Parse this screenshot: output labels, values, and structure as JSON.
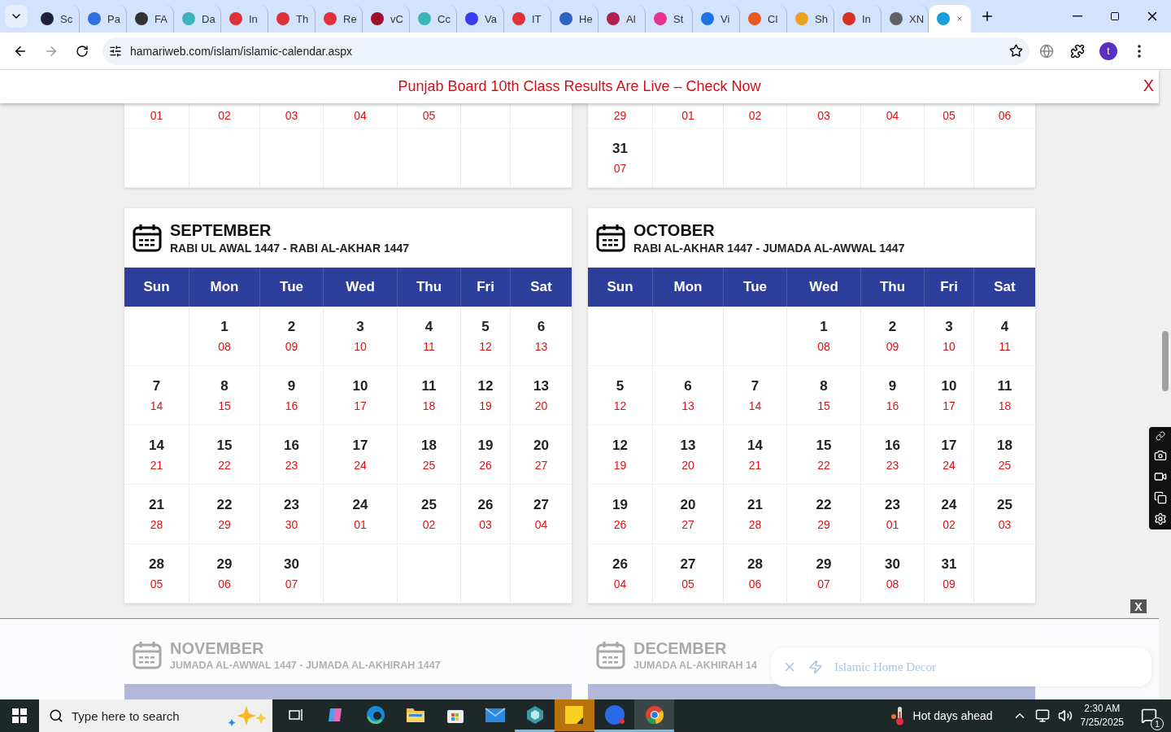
{
  "browser": {
    "tabs": [
      {
        "label": "Sc",
        "selected": false,
        "color": "#1f1f3a"
      },
      {
        "label": "Pa",
        "selected": false,
        "color": "#2f6fe0"
      },
      {
        "label": "FA",
        "selected": false,
        "color": "#333333"
      },
      {
        "label": "Da",
        "selected": false,
        "color": "#3bb3b8"
      },
      {
        "label": "In",
        "selected": false,
        "color": "#e0303a"
      },
      {
        "label": "Th",
        "selected": false,
        "color": "#e0303a"
      },
      {
        "label": "Re",
        "selected": false,
        "color": "#e0303a"
      },
      {
        "label": "vC",
        "selected": false,
        "color": "#a0102a"
      },
      {
        "label": "Cc",
        "selected": false,
        "color": "#3bb3b8"
      },
      {
        "label": "Va",
        "selected": false,
        "color": "#3a3af0"
      },
      {
        "label": "IT",
        "selected": false,
        "color": "#e0303a"
      },
      {
        "label": "He",
        "selected": false,
        "color": "#3060c0"
      },
      {
        "label": "Al",
        "selected": false,
        "color": "#b02050"
      },
      {
        "label": "St",
        "selected": false,
        "color": "#e83090"
      },
      {
        "label": "Vi",
        "selected": false,
        "color": "#1a73e8"
      },
      {
        "label": "Cl",
        "selected": false,
        "color": "#e85a20"
      },
      {
        "label": "Sh",
        "selected": false,
        "color": "#f0a020"
      },
      {
        "label": "In",
        "selected": false,
        "color": "#d93025"
      },
      {
        "label": "XN",
        "selected": false,
        "color": "#5f6368"
      },
      {
        "selected": true,
        "color": "#1aa0d8"
      }
    ],
    "url": "hamariweb.com/islam/islamic-calendar.aspx",
    "profile": "t"
  },
  "banner": {
    "text": "Punjab Board 10th Class Results Are Live – Check Now",
    "close": "X"
  },
  "previous_months": [
    {
      "rows": [
        [
          {
            "hijri": "01"
          },
          {
            "hijri": "02"
          },
          {
            "hijri": "03"
          },
          {
            "hijri": "04"
          },
          {
            "hijri": "05"
          },
          {},
          {}
        ],
        [
          {},
          {},
          {},
          {},
          {},
          {},
          {}
        ]
      ]
    },
    {
      "rows": [
        [
          {
            "hijri": "29"
          },
          {
            "hijri": "01"
          },
          {
            "hijri": "02"
          },
          {
            "hijri": "03"
          },
          {
            "hijri": "04"
          },
          {
            "hijri": "05"
          },
          {
            "hijri": "06"
          }
        ],
        [
          {
            "day": "31",
            "hijri": "07"
          },
          {},
          {},
          {},
          {},
          {},
          {}
        ]
      ]
    }
  ],
  "months": [
    {
      "name": "SEPTEMBER",
      "subtitle": "RABI UL AWAL 1447 - RABI AL-AKHAR 1447",
      "weekdays": [
        "Sun",
        "Mon",
        "Tue",
        "Wed",
        "Thu",
        "Fri",
        "Sat"
      ],
      "rows": [
        [
          {},
          {
            "day": "1",
            "hijri": "08"
          },
          {
            "day": "2",
            "hijri": "09"
          },
          {
            "day": "3",
            "hijri": "10"
          },
          {
            "day": "4",
            "hijri": "11"
          },
          {
            "day": "5",
            "hijri": "12"
          },
          {
            "day": "6",
            "hijri": "13"
          }
        ],
        [
          {
            "day": "7",
            "hijri": "14"
          },
          {
            "day": "8",
            "hijri": "15"
          },
          {
            "day": "9",
            "hijri": "16"
          },
          {
            "day": "10",
            "hijri": "17"
          },
          {
            "day": "11",
            "hijri": "18"
          },
          {
            "day": "12",
            "hijri": "19"
          },
          {
            "day": "13",
            "hijri": "20"
          }
        ],
        [
          {
            "day": "14",
            "hijri": "21"
          },
          {
            "day": "15",
            "hijri": "22"
          },
          {
            "day": "16",
            "hijri": "23"
          },
          {
            "day": "17",
            "hijri": "24"
          },
          {
            "day": "18",
            "hijri": "25"
          },
          {
            "day": "19",
            "hijri": "26"
          },
          {
            "day": "20",
            "hijri": "27"
          }
        ],
        [
          {
            "day": "21",
            "hijri": "28"
          },
          {
            "day": "22",
            "hijri": "29"
          },
          {
            "day": "23",
            "hijri": "30"
          },
          {
            "day": "24",
            "hijri": "01"
          },
          {
            "day": "25",
            "hijri": "02"
          },
          {
            "day": "26",
            "hijri": "03"
          },
          {
            "day": "27",
            "hijri": "04"
          }
        ],
        [
          {
            "day": "28",
            "hijri": "05"
          },
          {
            "day": "29",
            "hijri": "06"
          },
          {
            "day": "30",
            "hijri": "07"
          },
          {},
          {},
          {},
          {}
        ]
      ]
    },
    {
      "name": "OCTOBER",
      "subtitle": "RABI AL-AKHAR 1447 - JUMADA AL-AWWAL 1447",
      "weekdays": [
        "Sun",
        "Mon",
        "Tue",
        "Wed",
        "Thu",
        "Fri",
        "Sat"
      ],
      "rows": [
        [
          {},
          {},
          {},
          {
            "day": "1",
            "hijri": "08"
          },
          {
            "day": "2",
            "hijri": "09"
          },
          {
            "day": "3",
            "hijri": "10"
          },
          {
            "day": "4",
            "hijri": "11"
          }
        ],
        [
          {
            "day": "5",
            "hijri": "12"
          },
          {
            "day": "6",
            "hijri": "13"
          },
          {
            "day": "7",
            "hijri": "14"
          },
          {
            "day": "8",
            "hijri": "15"
          },
          {
            "day": "9",
            "hijri": "16"
          },
          {
            "day": "10",
            "hijri": "17"
          },
          {
            "day": "11",
            "hijri": "18"
          }
        ],
        [
          {
            "day": "12",
            "hijri": "19"
          },
          {
            "day": "13",
            "hijri": "20"
          },
          {
            "day": "14",
            "hijri": "21"
          },
          {
            "day": "15",
            "hijri": "22"
          },
          {
            "day": "16",
            "hijri": "23"
          },
          {
            "day": "17",
            "hijri": "24"
          },
          {
            "day": "18",
            "hijri": "25"
          }
        ],
        [
          {
            "day": "19",
            "hijri": "26"
          },
          {
            "day": "20",
            "hijri": "27"
          },
          {
            "day": "21",
            "hijri": "28"
          },
          {
            "day": "22",
            "hijri": "29"
          },
          {
            "day": "23",
            "hijri": "01"
          },
          {
            "day": "24",
            "hijri": "02"
          },
          {
            "day": "25",
            "hijri": "03"
          }
        ],
        [
          {
            "day": "26",
            "hijri": "04"
          },
          {
            "day": "27",
            "hijri": "05"
          },
          {
            "day": "28",
            "hijri": "06"
          },
          {
            "day": "29",
            "hijri": "07"
          },
          {
            "day": "30",
            "hijri": "08"
          },
          {
            "day": "31",
            "hijri": "09"
          },
          {}
        ]
      ]
    }
  ],
  "ad_overlay": {
    "close": "X",
    "faded_months": [
      {
        "name": "NOVEMBER",
        "subtitle": "JUMADA AL-AWWAL 1447 - JUMADA AL-AKHIRAH 1447"
      },
      {
        "name": "DECEMBER",
        "subtitle": "JUMADA AL-AKHIRAH 14"
      }
    ],
    "ad_label": "Islamic Home Decor"
  },
  "taskbar": {
    "search_placeholder": "Type here to search",
    "apps": [
      {
        "kind": "taskview",
        "running": false,
        "selected": false
      },
      {
        "kind": "copilot",
        "running": false,
        "selected": false
      },
      {
        "kind": "edge",
        "running": false,
        "selected": false
      },
      {
        "kind": "folder",
        "running": false,
        "selected": false
      },
      {
        "kind": "store",
        "running": false,
        "selected": false
      },
      {
        "kind": "mail",
        "running": false,
        "selected": false
      },
      {
        "kind": "cube",
        "running": true,
        "selected": false
      },
      {
        "kind": "notes",
        "running": false,
        "selected": false
      },
      {
        "kind": "zoom",
        "running": true,
        "selected": false
      },
      {
        "kind": "chrome",
        "running": true,
        "selected": true
      }
    ],
    "weather": "Hot days ahead",
    "time": "2:30 AM",
    "date": "7/25/2025",
    "notifications": "1"
  }
}
